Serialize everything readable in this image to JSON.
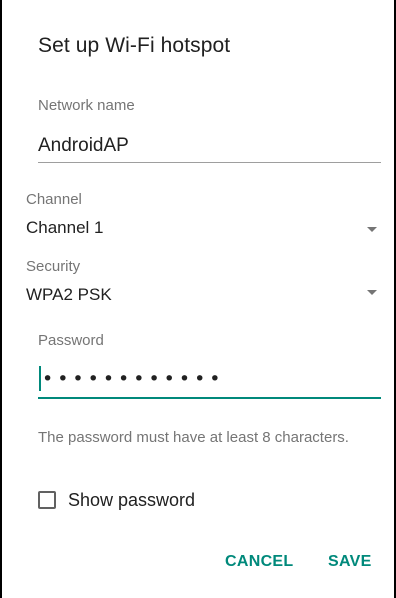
{
  "dialog": {
    "title": "Set up Wi-Fi hotspot"
  },
  "network_name": {
    "label": "Network name",
    "value": "AndroidAP"
  },
  "channel": {
    "label": "Channel",
    "selected": "Channel 1"
  },
  "security": {
    "label": "Security",
    "selected": "WPA2 PSK"
  },
  "password": {
    "label": "Password",
    "masked_value": "••••••••••••",
    "helper_text": "The password must have at least 8 characters."
  },
  "show_password": {
    "label": "Show password",
    "checked": false
  },
  "actions": {
    "cancel_label": "CANCEL",
    "save_label": "SAVE"
  },
  "colors": {
    "accent": "#00897b",
    "label_gray": "#757575",
    "text": "#212121"
  }
}
